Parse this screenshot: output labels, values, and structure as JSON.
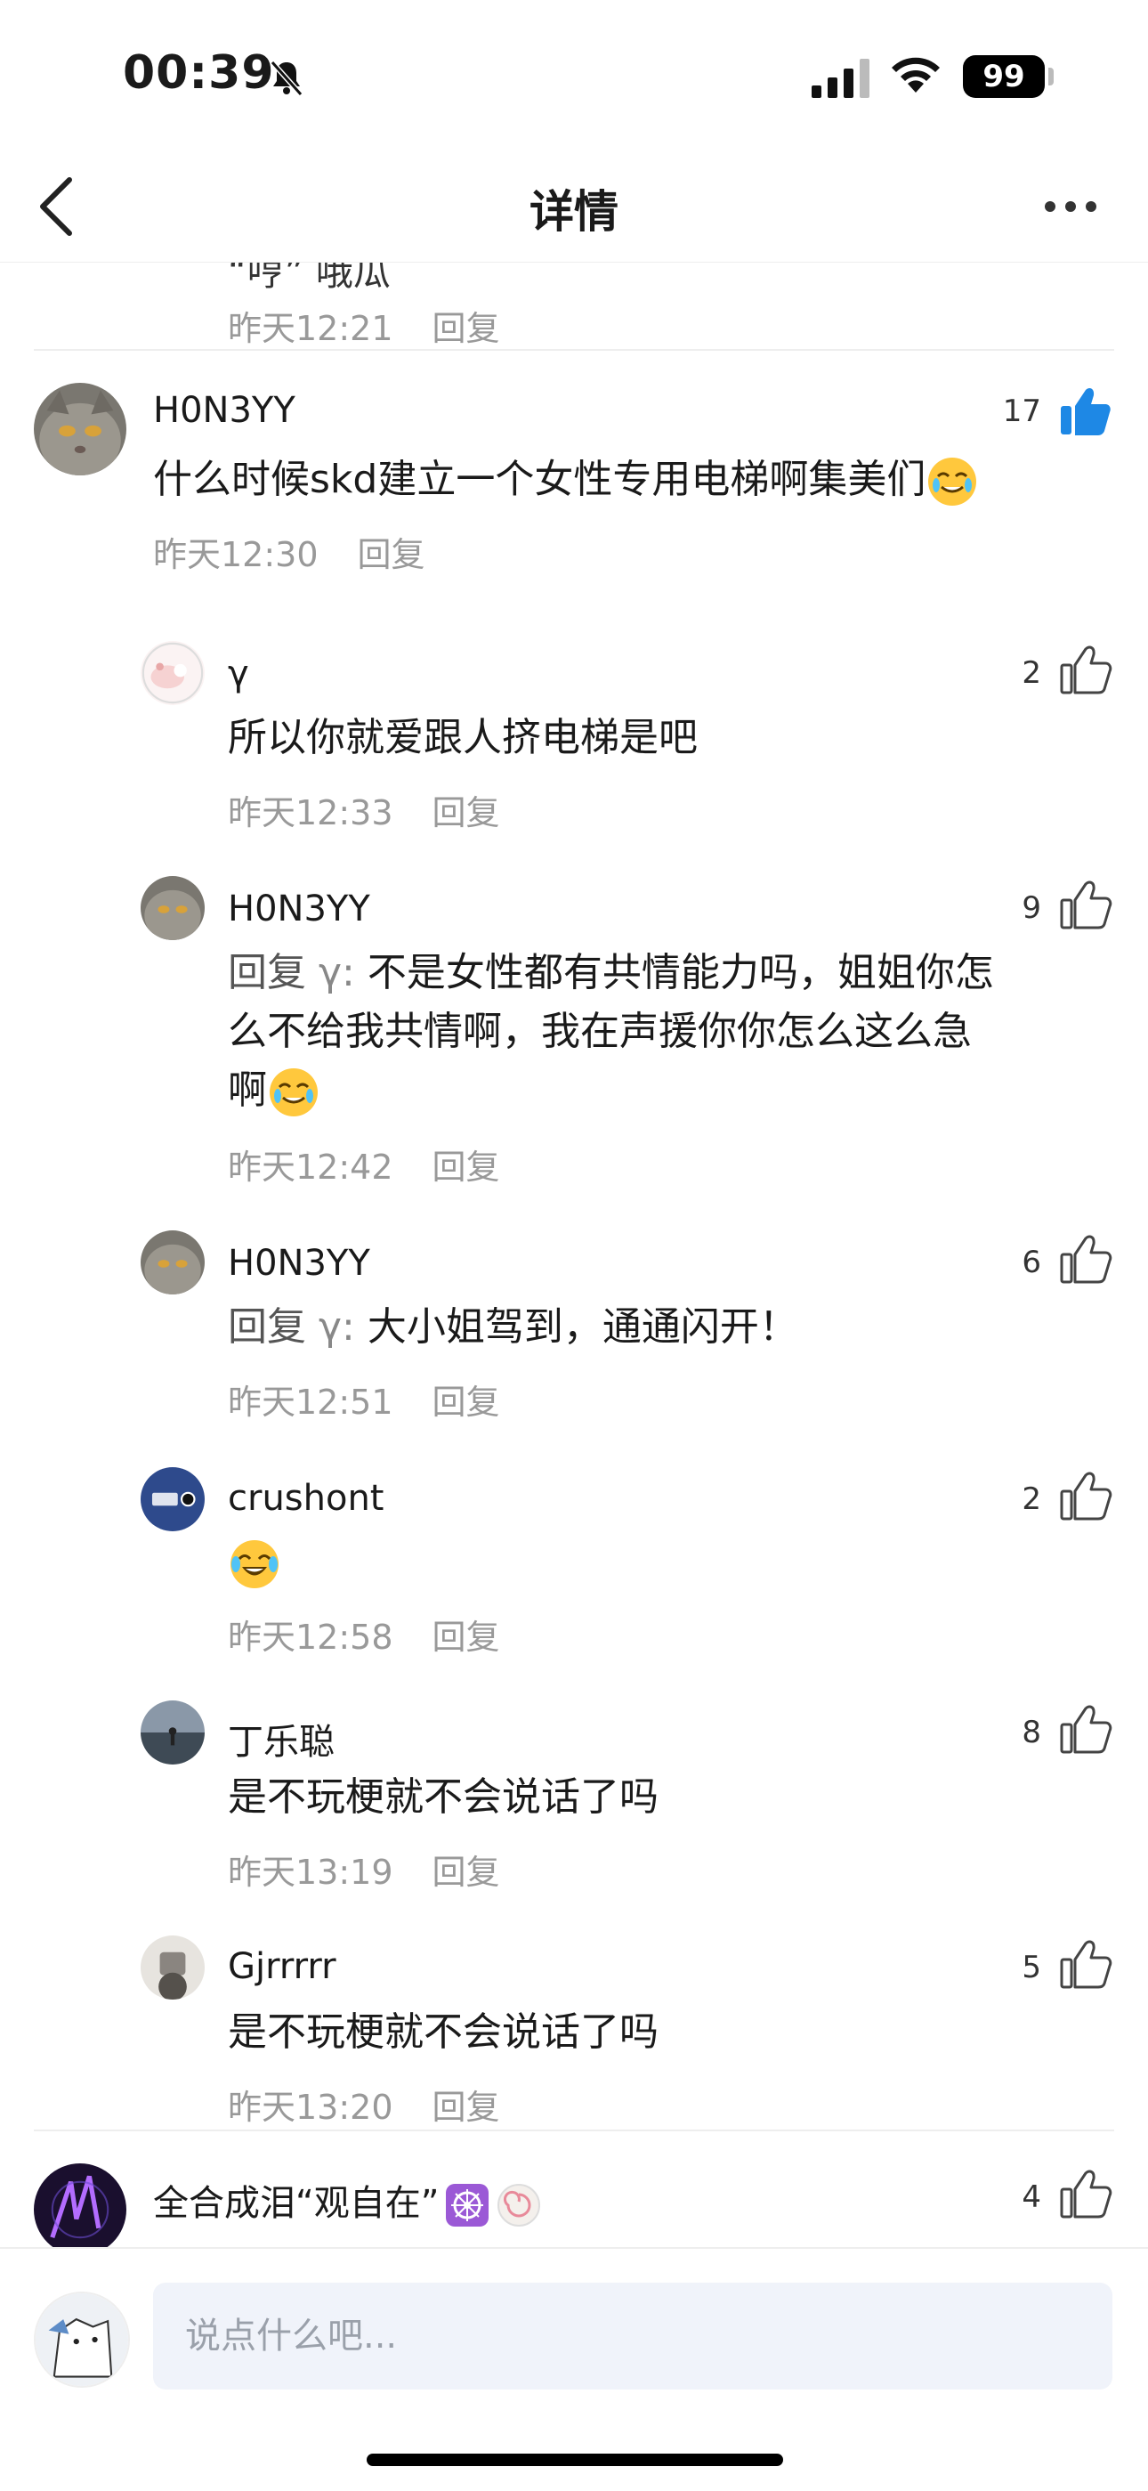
{
  "status_bar": {
    "time": "00:39",
    "battery": "99"
  },
  "nav": {
    "title": "详情"
  },
  "top_clipped": {
    "text": "“哼” 哦瓜",
    "time": "昨天12:21",
    "reply": "回复"
  },
  "main_comment": {
    "username": "H0N3YY",
    "likes": "17",
    "liked": true,
    "text": "什么时候skd建立一个女性专用电梯啊集美们",
    "time": "昨天12:30",
    "reply": "回复"
  },
  "replies": [
    {
      "username": "γ",
      "likes": "2",
      "text": "所以你就爱跟人挤电梯是吧",
      "time": "昨天12:33",
      "reply": "回复"
    },
    {
      "username": "H0N3YY",
      "likes": "9",
      "reply_prefix": "回复",
      "reply_to": "γ:",
      "text_lines": [
        "不是女性都有共情能力吗，姐姐你怎",
        "么不给我共情啊，我在声援你你怎么这么急",
        "啊"
      ],
      "time": "昨天12:42",
      "reply": "回复"
    },
    {
      "username": "H0N3YY",
      "likes": "6",
      "reply_prefix": "回复",
      "reply_to": "γ:",
      "text": "大小姐驾到，通通闪开！",
      "time": "昨天12:51",
      "reply": "回复"
    },
    {
      "username": "crushont",
      "likes": "2",
      "text": "",
      "time": "昨天12:58",
      "reply": "回复"
    },
    {
      "username": "丁乐聪",
      "likes": "8",
      "text": "是不玩梗就不会说话了吗",
      "time": "昨天13:19",
      "reply": "回复"
    },
    {
      "username": "Gjrrrrr",
      "likes": "5",
      "text": "是不玩梗就不会说话了吗",
      "time": "昨天13:20",
      "reply": "回复"
    }
  ],
  "next_comment": {
    "username": "全合成泪“观自在”",
    "likes": "4"
  },
  "input": {
    "placeholder": "说点什么吧..."
  },
  "colors": {
    "accent_like": "#1e88e5",
    "meta": "#999999",
    "input_bg": "#f0f3fa"
  }
}
